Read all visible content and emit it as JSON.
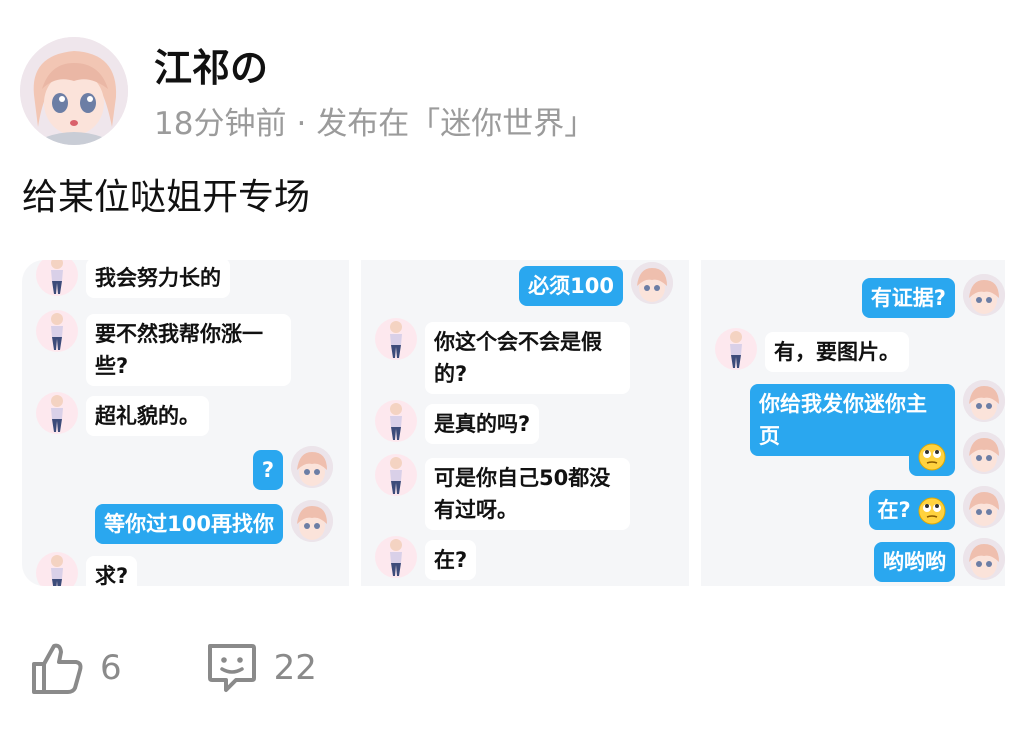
{
  "post": {
    "author": "江祁の",
    "time": "18分钟前",
    "separator": "·",
    "published_in": "发布在「迷你世界」",
    "text": "给某位哒姐开专场"
  },
  "screenshots": [
    {
      "messages": [
        {
          "side": "left",
          "text": "我会努力长的"
        },
        {
          "side": "left",
          "text": "要不然我帮你涨一些?"
        },
        {
          "side": "left",
          "text": "超礼貌的。"
        },
        {
          "side": "right",
          "text": "?"
        },
        {
          "side": "right",
          "text": "等你过100再找你"
        },
        {
          "side": "left",
          "text": "求?"
        }
      ]
    },
    {
      "messages": [
        {
          "side": "right",
          "text": "必须100"
        },
        {
          "side": "left",
          "text": "你这个会不会是假的?"
        },
        {
          "side": "left",
          "text": "是真的吗?"
        },
        {
          "side": "left",
          "text": "可是你自己50都没有过呀。"
        },
        {
          "side": "left",
          "text": "在?"
        }
      ]
    },
    {
      "messages": [
        {
          "side": "right",
          "text": "有证据?"
        },
        {
          "side": "left",
          "text": "有，要图片。"
        },
        {
          "side": "right",
          "text": "你给我发你迷你主页"
        },
        {
          "side": "right",
          "text": "",
          "emoji": "eye-roll-emoji"
        },
        {
          "side": "right",
          "text": "在?",
          "emoji": "eye-roll-emoji"
        },
        {
          "side": "right",
          "text": "哟哟哟"
        }
      ]
    }
  ],
  "actions": {
    "like_count": "6",
    "comment_count": "22"
  },
  "colors": {
    "accent_bubble": "#2aa7ef",
    "panel_bg": "#f5f6f8",
    "muted_text": "#9b9b9b"
  }
}
